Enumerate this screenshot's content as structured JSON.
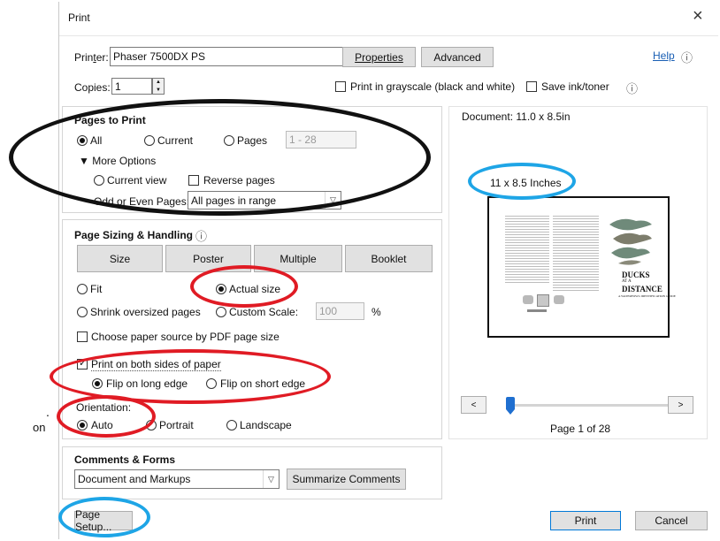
{
  "outside": {
    "bullet": ".",
    "fragment": "on"
  },
  "window": {
    "title": "Print",
    "close_glyph": "×"
  },
  "header": {
    "printer_label_pre": "Prin",
    "printer_label_u": "t",
    "printer_label_post": "er:",
    "printer_value": "Phaser 7500DX PS",
    "properties_label": "Properties",
    "advanced_label": "Advanced",
    "help_label": "Help",
    "copies_label": "Copies:",
    "copies_value": "1",
    "grayscale_label": "Print in grayscale (black and white)",
    "save_ink_label": "Save ink/toner",
    "info_glyph": "ⓘ"
  },
  "pages_to_print": {
    "title": "Pages to Print",
    "all_label": "All",
    "current_label": "Current",
    "pages_label": "Pages",
    "pages_range": "1 - 28",
    "more_options_label": "▼ More Options",
    "current_view_label": "Current view",
    "reverse_pages_label": "Reverse pages",
    "odd_even_label": "Odd or Even Pages:",
    "odd_even_value": "All pages in range"
  },
  "page_sizing": {
    "title": "Page Sizing & Handling",
    "tab_size": "Size",
    "tab_poster": "Poster",
    "tab_multiple": "Multiple",
    "tab_booklet": "Booklet",
    "fit_label": "Fit",
    "actual_size_label": "Actual size",
    "shrink_label": "Shrink oversized pages",
    "custom_scale_label": "Custom Scale:",
    "custom_scale_value": "100",
    "percent": "%",
    "paper_source_label": "Choose paper source by PDF page size",
    "both_sides_label": "Print on both sides of paper",
    "flip_long_label": "Flip on long edge",
    "flip_short_label": "Flip on short edge",
    "orientation_label": "Orientation:",
    "auto_label": "Auto",
    "portrait_label": "Portrait",
    "landscape_label": "Landscape"
  },
  "comments_forms": {
    "title": "Comments & Forms",
    "value": "Document and Markups",
    "summarize_label": "Summarize Comments"
  },
  "preview": {
    "document_label": "Document: 11.0 x 8.5in",
    "paper_size": "11 x 8.5 Inches",
    "doc_title": "DUCKS",
    "doc_at": "AT A",
    "doc_distance": "DISTANCE",
    "doc_subtitle": "A WATERFOWL IDENTIFICATION GUIDE",
    "prev_label": "<",
    "next_label": ">",
    "page_indicator": "Page 1 of 28",
    "slider_position": 0.0
  },
  "footer": {
    "page_setup_label": "Page Setup...",
    "print_label": "Print",
    "cancel_label": "Cancel"
  },
  "colors": {
    "annotation_black": "#111111",
    "annotation_red": "#e01b24",
    "annotation_blue": "#1ea5e6",
    "slider_thumb": "#1f6fd0"
  }
}
